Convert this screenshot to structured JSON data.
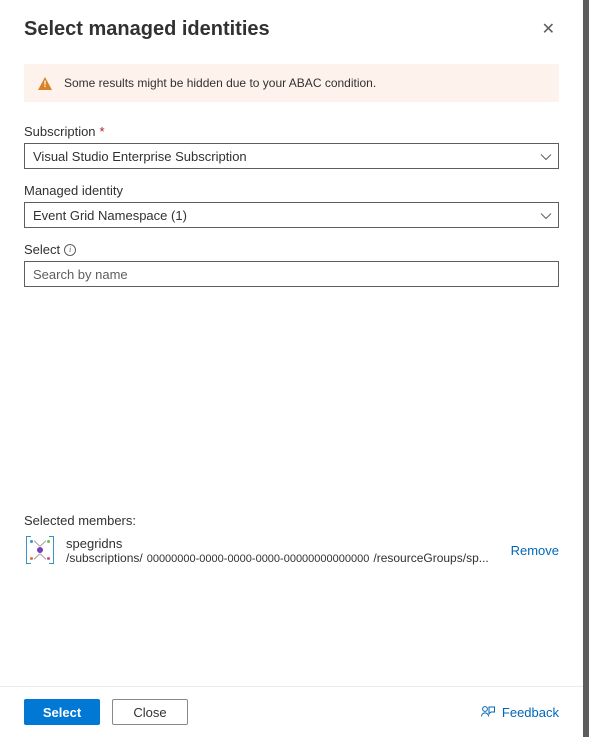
{
  "title": "Select managed identities",
  "warning": {
    "text": "Some results might be hidden due to your ABAC condition."
  },
  "fields": {
    "subscription": {
      "label": "Subscription",
      "required": true,
      "value": "Visual Studio Enterprise Subscription"
    },
    "managedIdentity": {
      "label": "Managed identity",
      "value": "Event Grid Namespace (1)"
    },
    "select": {
      "label": "Select",
      "placeholder": "Search by name"
    }
  },
  "selectedMembers": {
    "label": "Selected members:",
    "items": [
      {
        "name": "spegridns",
        "pathPrefix": "/subscriptions/",
        "guid": "00000000-0000-0000-0000-00000000000000",
        "pathSuffix": "/resourceGroups/sp...",
        "removeLabel": "Remove"
      }
    ]
  },
  "footer": {
    "selectLabel": "Select",
    "closeLabel": "Close",
    "feedbackLabel": "Feedback"
  }
}
